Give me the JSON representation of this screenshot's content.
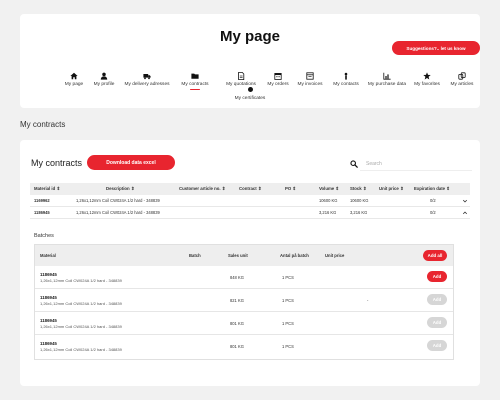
{
  "header": {
    "title": "My page",
    "suggestion_label": "Suggestions?.. let us know"
  },
  "nav": {
    "items": [
      {
        "label": "My page",
        "icon": "home-icon"
      },
      {
        "label": "My profile",
        "icon": "user-icon"
      },
      {
        "label": "My delivery adresses",
        "icon": "truck-icon"
      },
      {
        "label": "My contracts",
        "icon": "folder-icon",
        "active": true
      },
      {
        "label": "My quotations",
        "icon": "document-icon"
      },
      {
        "label": "My orders",
        "icon": "calendar-icon"
      },
      {
        "label": "My invoices",
        "icon": "invoice-icon"
      },
      {
        "label": "My contacts",
        "icon": "contact-icon"
      },
      {
        "label": "My purchase data",
        "icon": "chart-icon"
      },
      {
        "label": "My favorites",
        "icon": "star-icon"
      },
      {
        "label": "My articles",
        "icon": "article-icon"
      }
    ],
    "certificates_label": "My certificates"
  },
  "section_title": "My contracts",
  "contracts": {
    "title": "My contracts",
    "download_label": "Download data excel",
    "search_placeholder": "Search",
    "columns": [
      "Material id ⇕",
      "Description ⇕",
      "Customer article no. ⇕",
      "Contract ⇕",
      "PO ⇕",
      "Volume ⇕",
      "Stock ⇕",
      "Unit price ⇕",
      "Expiration date ⇕"
    ],
    "rows": [
      {
        "material_id": "1169962",
        "description": "1,26x1,12mm Coil CW024A 1/2 hard - 348839",
        "customer_article": "",
        "contract": "",
        "po": "",
        "volume": "10600 KG",
        "stock": "10600 KG",
        "unit_price": "",
        "expiration": "0/2",
        "expanded": false
      },
      {
        "material_id": "1186945",
        "description": "1,26x1,12mm Coil CW024A 1/2 hard - 348839",
        "customer_article": "",
        "contract": "",
        "po": "",
        "volume": "3,216 KG",
        "stock": "3,216 KG",
        "unit_price": "",
        "expiration": "0/2",
        "expanded": true
      }
    ]
  },
  "batches": {
    "title": "Batches",
    "columns": [
      "Material",
      "Batch",
      "Sales unit",
      "Antal på batch",
      "Unit price"
    ],
    "add_all_label": "Add all",
    "rows": [
      {
        "material_id": "1186945",
        "description": "1,26x1,12mm Coil CW024A 1/2 hard - 348839",
        "sales_unit": "848 KG",
        "qty": "1 PCS",
        "unit_price": "",
        "add_label": "Add",
        "enabled": true
      },
      {
        "material_id": "1186945",
        "description": "1,26x1,12mm Coil CW024A 1/2 hard - 348839",
        "sales_unit": "821 KG",
        "qty": "1 PCS",
        "unit_price": "-",
        "add_label": "Add",
        "enabled": false
      },
      {
        "material_id": "1186945",
        "description": "1,26x1,12mm Coil CW024A 1/2 hard - 348839",
        "sales_unit": "801 KG",
        "qty": "1 PCS",
        "unit_price": "",
        "add_label": "Add",
        "enabled": false
      },
      {
        "material_id": "1186945",
        "description": "1,26x1,12mm Coil CW024A 1/2 hard - 348839",
        "sales_unit": "801 KG",
        "qty": "1 PCS",
        "unit_price": "",
        "add_label": "Add",
        "enabled": false
      }
    ]
  },
  "colors": {
    "accent": "#e8252f",
    "background": "#f1f1f1",
    "card": "#ffffff",
    "header_row": "#eeeeee",
    "disabled_button": "#d6d6d6"
  }
}
